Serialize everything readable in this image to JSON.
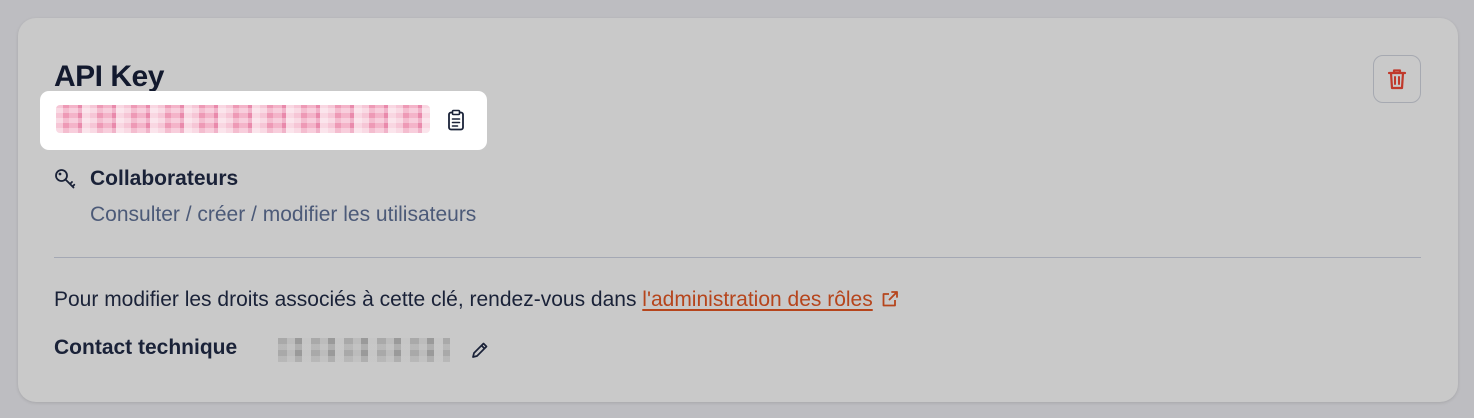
{
  "api_key": {
    "title": "API Key",
    "key_value": "••••••••••••••••••••••••••••••••",
    "copy_icon": "clipboard-icon",
    "delete_icon": "trash-icon"
  },
  "permission": {
    "icon": "key-icon",
    "name": "Collaborateurs",
    "description": "Consulter / créer / modifier les utilisateurs"
  },
  "info": {
    "text": "Pour modifier les droits associés à cette clé, rendez-vous dans ",
    "link_label": "l'administration des rôles",
    "link_icon": "external-link-icon"
  },
  "contact": {
    "label": "Contact technique",
    "value": "••••••••••••",
    "edit_icon": "pencil-icon"
  },
  "colors": {
    "title": "#12192e",
    "link": "#b6451c",
    "delete": "#c0392b",
    "muted_text": "#4c5a78",
    "card_bg": "#c9c9c9"
  }
}
